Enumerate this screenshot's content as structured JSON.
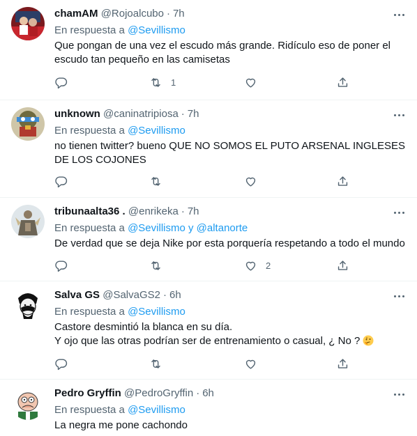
{
  "reply_prefix": "En respuesta a",
  "tweets": [
    {
      "name": "chamAM",
      "handle": "@Rojoalcubo",
      "dot": "·",
      "time": "7h",
      "reply_to": "@Sevillismo",
      "lines": [
        "Que pongan de una vez el escudo más grande. Ridículo eso de poner el",
        "escudo tan pequeño en las camisetas"
      ],
      "retweets": "1",
      "likes": ""
    },
    {
      "name": "unknown",
      "handle": "@caninatripiosa",
      "dot": "·",
      "time": "7h",
      "reply_to": "@Sevillismo",
      "lines": [
        "no tienen twitter? bueno QUE NO SOMOS EL PUTO ARSENAL INGLESES",
        "DE LOS COJONES"
      ],
      "retweets": "",
      "likes": ""
    },
    {
      "name": "tribunaalta36 .",
      "handle": "@enrikeka",
      "dot": "·",
      "time": "7h",
      "reply_to": "@Sevillismo y @altanorte",
      "lines": [
        "De verdad que se deja Nike por esta  porquería respetando a todo el mundo"
      ],
      "retweets": "",
      "likes": "2"
    },
    {
      "name": "Salva GS",
      "handle": "@SalvaGS2",
      "dot": "·",
      "time": "6h",
      "reply_to": "@Sevillismo",
      "lines": [
        "Castore desmintió la blanca en su día.",
        "Y ojo que las otras podrían ser de entrenamiento o casual, ¿ No ?"
      ],
      "retweets": "",
      "likes": ""
    },
    {
      "name": "Pedro Gryffin",
      "handle": "@PedroGryffin",
      "dot": "·",
      "time": "6h",
      "reply_to": "@Sevillismo",
      "lines": [
        "La negra me pone cachondo"
      ],
      "retweets": "",
      "likes": ""
    }
  ],
  "icons": {
    "reply": "reply-icon",
    "retweet": "retweet-icon",
    "like": "heart-icon",
    "share": "share-icon",
    "more": "more-icon",
    "thinking": "thinking-face-emoji"
  },
  "colors": {
    "link": "#1d9bf0",
    "secondary": "#536471",
    "text": "#0f1419",
    "divider": "#eff3f4"
  }
}
